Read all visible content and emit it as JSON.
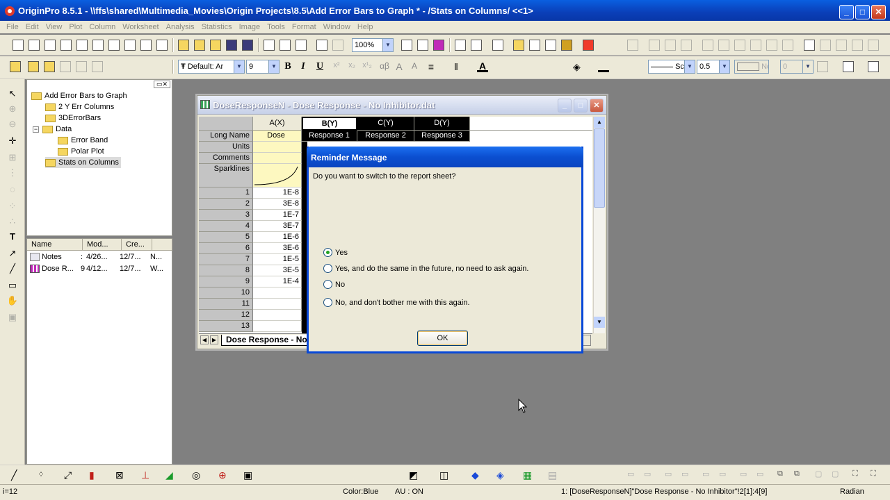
{
  "app": {
    "title": "OriginPro 8.5.1 - \\\\ffs\\shared\\Multimedia_Movies\\Origin Projects\\8.5\\Add Error Bars to Graph * - /Stats on Columns/ <<1>",
    "window_buttons": [
      "_",
      "□",
      "✕"
    ]
  },
  "menu": [
    "File",
    "Edit",
    "View",
    "Plot",
    "Column",
    "Worksheet",
    "Analysis",
    "Statistics",
    "Image",
    "Tools",
    "Format",
    "Window",
    "Help"
  ],
  "toolbar": {
    "zoom": "100%",
    "font_name": "Default: Ar",
    "font_size": "9",
    "bold": "B",
    "italic": "I",
    "underline": "U",
    "greek": "αβ",
    "line_width": "0.5",
    "line_style_label": "Sc",
    "fill_label": "Nc",
    "pattern_value": "0"
  },
  "project_tree": {
    "root": "Add Error Bars to Graph",
    "items": [
      {
        "label": "2 Y Err Columns",
        "level": 1
      },
      {
        "label": "3DErrorBars",
        "level": 1
      },
      {
        "label": "Data",
        "level": 1,
        "expander": "−"
      },
      {
        "label": "Error Band",
        "level": 2
      },
      {
        "label": "Polar Plot",
        "level": 2
      },
      {
        "label": "Stats on Columns",
        "level": 1,
        "selected": true
      }
    ]
  },
  "file_list": {
    "columns": [
      "Name",
      "Mod...",
      "Cre..."
    ],
    "rows": [
      {
        "name": "Notes",
        "c1": ":",
        "modified": "4/26...",
        "created": "12/7...",
        "extra": "N..."
      },
      {
        "name": "Dose R...",
        "c1": "9",
        "modified": "4/12...",
        "created": "12/7...",
        "extra": "W..."
      }
    ]
  },
  "worksheet": {
    "title": "DoseResponseN - Dose Response - No Inhibitor.dat",
    "columns": [
      "A(X)",
      "B(Y)",
      "C(Y)",
      "D(Y)"
    ],
    "row_labels": [
      "Long Name",
      "Units",
      "Comments",
      "Sparklines"
    ],
    "long_names": [
      "Dose",
      "Response 1",
      "Response 2",
      "Response 3"
    ],
    "row_numbers": [
      "1",
      "2",
      "3",
      "4",
      "5",
      "6",
      "7",
      "8",
      "9",
      "10",
      "11",
      "12",
      "13"
    ],
    "dose_values": [
      "1E-8",
      "3E-8",
      "1E-7",
      "3E-7",
      "1E-6",
      "3E-6",
      "1E-5",
      "3E-5",
      "1E-4",
      "",
      "",
      "",
      ""
    ],
    "sheet_tab": "Dose Response - No"
  },
  "dialog": {
    "title": "Reminder Message",
    "message": "Do you want to switch to the report sheet?",
    "options": [
      {
        "label": "Yes",
        "selected": true
      },
      {
        "label": "Yes, and do the same in the future, no need to ask again.",
        "selected": false
      },
      {
        "label": "No",
        "selected": false
      },
      {
        "label": "No, and don't bother me with this again.",
        "selected": false
      }
    ],
    "ok_label": "OK"
  },
  "status": {
    "left": "i=12",
    "color": "Color:Blue",
    "au": "AU : ON",
    "cell": "1: [DoseResponseN]\"Dose Response - No Inhibitor\"!2[1]:4[9]",
    "angle": "Radian"
  },
  "colors": {
    "title_blue": "#0a4fd0",
    "workspace_gray": "#808080",
    "panel_beige": "#ece9d8",
    "header_yellow": "#fdf8c0",
    "selected_column_black": "#000000"
  }
}
